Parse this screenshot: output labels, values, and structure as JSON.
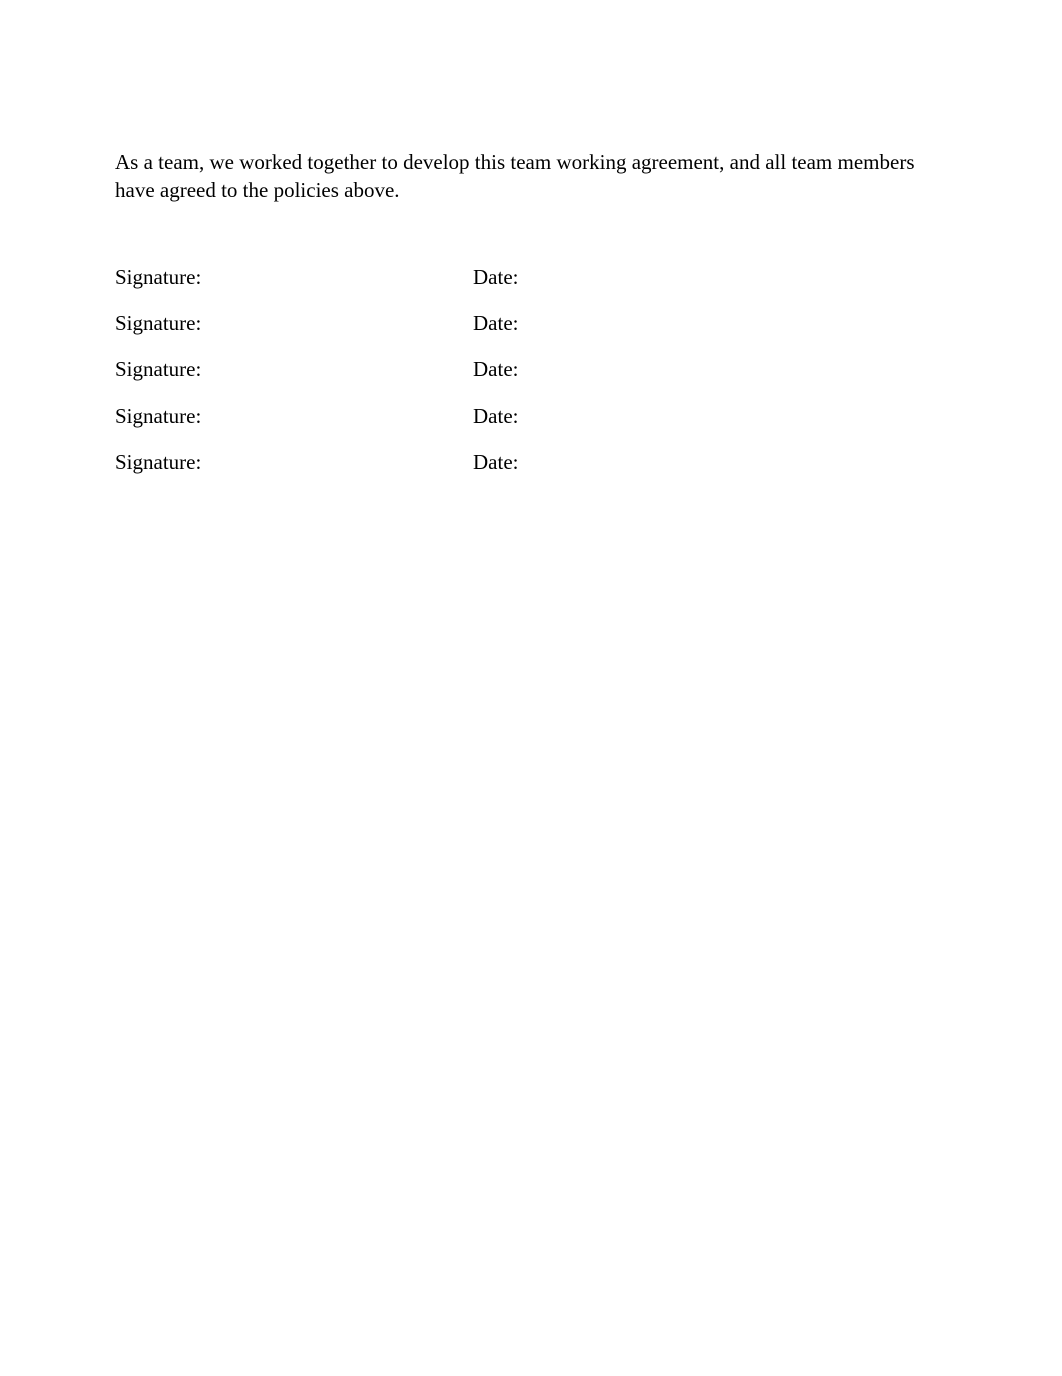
{
  "intro_text": "As a team, we worked together to develop this team working agreement, and all team members have agreed to the policies above.",
  "rows": [
    {
      "signature_label": "Signature:",
      "date_label": "Date:"
    },
    {
      "signature_label": "Signature:",
      "date_label": "Date:"
    },
    {
      "signature_label": "Signature:",
      "date_label": "Date:"
    },
    {
      "signature_label": "Signature:",
      "date_label": "Date:"
    },
    {
      "signature_label": "Signature:",
      "date_label": "Date:"
    }
  ]
}
